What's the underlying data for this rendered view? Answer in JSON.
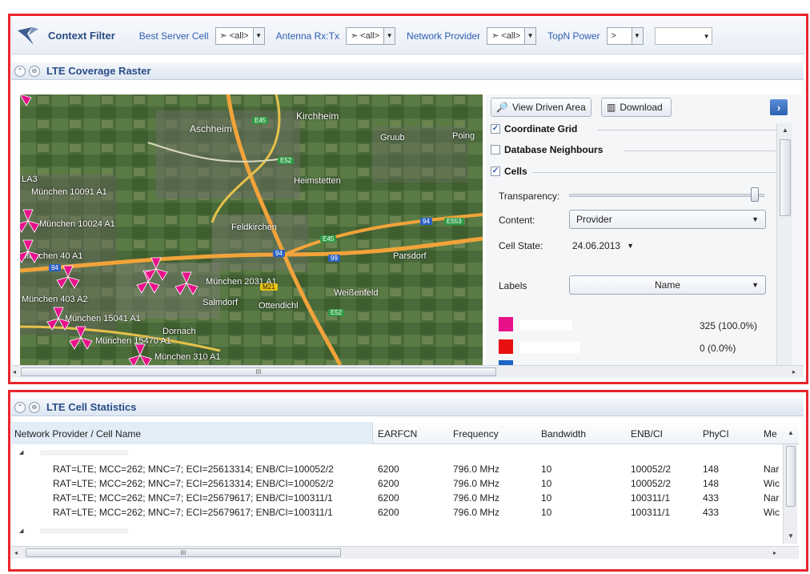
{
  "context_filter": {
    "title": "Context Filter",
    "filters": [
      {
        "label": "Best Server Cell",
        "value": "<all>"
      },
      {
        "label": "Antenna Rx:Tx",
        "value": "<all>"
      },
      {
        "label": "Network Provider",
        "value": "<all>"
      }
    ],
    "last_filter": {
      "label": "TopN Power",
      "operator": ">",
      "value": ""
    }
  },
  "coverage_panel": {
    "title": "LTE Coverage Raster",
    "map": {
      "places": [
        "Aschheim",
        "Kirchheim",
        "Heimstetten",
        "Feldkirchen",
        "Parsdorf",
        "Weißenfeld",
        "Salmdorf",
        "Dornach",
        "Ottendichl",
        "Gruub",
        "Poing"
      ],
      "cell_labels": [
        "München 10091 A1",
        "München 10024 A1",
        "München 40 A1",
        "München 403 A2",
        "München 15041 A1",
        "München 15470 A1",
        "München 2031 A1",
        "München 310 A1",
        "LA3"
      ],
      "roads": {
        "green": [
          "E45",
          "E52",
          "E45",
          "E52",
          "E553"
        ],
        "blue": [
          "94",
          "94",
          "99",
          "94"
        ],
        "yellow": [
          "M21"
        ]
      }
    },
    "toolbar": {
      "view_driven_area": "View Driven Area",
      "download": "Download"
    },
    "sections": [
      {
        "label": "Coordinate Grid",
        "checked": true
      },
      {
        "label": "Database Neighbours",
        "checked": false
      },
      {
        "label": "Cells",
        "checked": true
      }
    ],
    "form": {
      "transparency_label": "Transparency:",
      "transparency_value": 0.97,
      "content_label": "Content:",
      "content_value": "Provider",
      "cell_state_label": "Cell State:",
      "cell_state_value": "24.06.2013",
      "labels_label": "Labels",
      "labels_value": "Name"
    },
    "legend": [
      {
        "color": "#e8118a",
        "value": "325 (100.0%)"
      },
      {
        "color": "#e81010",
        "value": "0 (0.0%)"
      },
      {
        "color": "#1d63c4",
        "value": ""
      }
    ],
    "hscroll_grip": "III"
  },
  "statistics_panel": {
    "title": "LTE Cell Statistics",
    "columns": [
      "Network Provider / Cell Name",
      "EARFCN",
      "Frequency",
      "Bandwidth",
      "ENB/CI",
      "PhyCI",
      "Me"
    ],
    "rows": [
      {
        "name": "RAT=LTE; MCC=262; MNC=7; ECI=25613314; ENB/CI=100052/2",
        "earfcn": "6200",
        "frequency": "796.0 MHz",
        "bandwidth": "10",
        "enbci": "100052/2",
        "phyci": "148",
        "me": "Nar"
      },
      {
        "name": "RAT=LTE; MCC=262; MNC=7; ECI=25613314; ENB/CI=100052/2",
        "earfcn": "6200",
        "frequency": "796.0 MHz",
        "bandwidth": "10",
        "enbci": "100052/2",
        "phyci": "148",
        "me": "Wic"
      },
      {
        "name": "RAT=LTE; MCC=262; MNC=7; ECI=25679617; ENB/CI=100311/1",
        "earfcn": "6200",
        "frequency": "796.0 MHz",
        "bandwidth": "10",
        "enbci": "100311/1",
        "phyci": "433",
        "me": "Nar"
      },
      {
        "name": "RAT=LTE; MCC=262; MNC=7; ECI=25679617; ENB/CI=100311/1",
        "earfcn": "6200",
        "frequency": "796.0 MHz",
        "bandwidth": "10",
        "enbci": "100311/1",
        "phyci": "433",
        "me": "Wic"
      }
    ],
    "hscroll_grip": "III"
  },
  "colors": {
    "accent_red": "#e8262d",
    "header_blue": "#2a4d86",
    "cell_magenta": "#e8118a"
  }
}
